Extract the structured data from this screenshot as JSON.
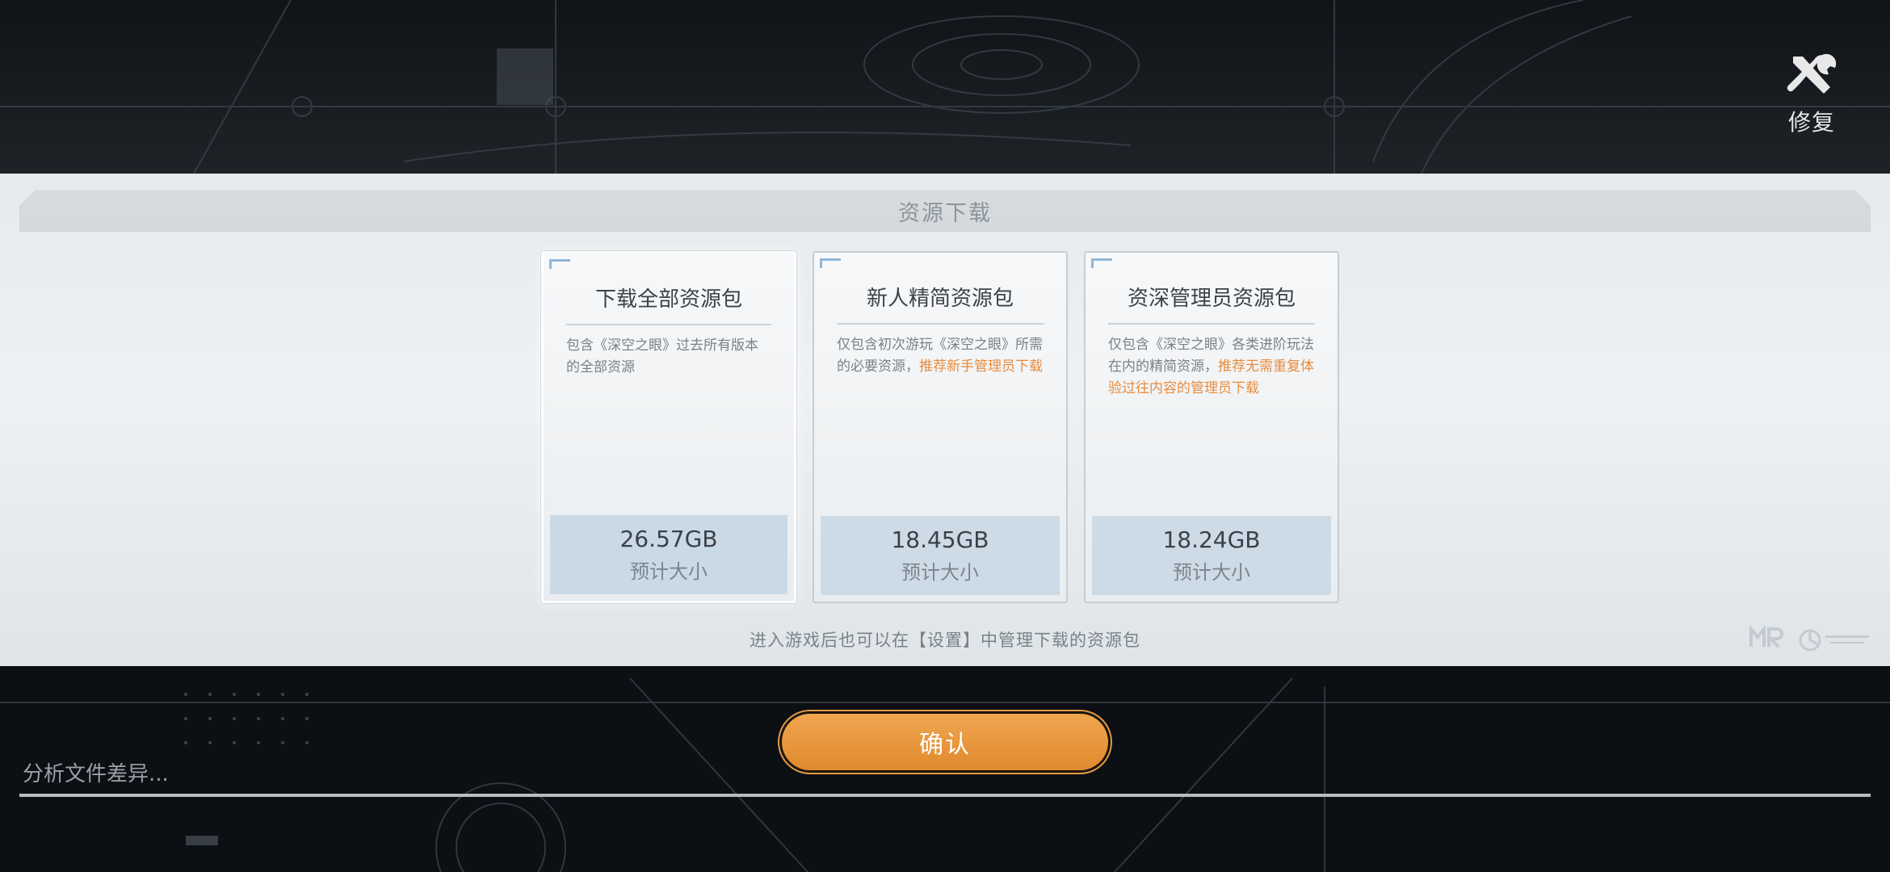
{
  "repair": {
    "label": "修复",
    "icon": "tools-icon"
  },
  "panel": {
    "title": "资源下载",
    "footer_note": "进入游戏后也可以在【设置】中管理下载的资源包"
  },
  "cards": [
    {
      "title": "下载全部资源包",
      "desc_plain": "包含《深空之眼》过去所有版本的全部资源",
      "desc_highlight": "",
      "size": "26.57GB",
      "size_label": "预计大小",
      "selected": true
    },
    {
      "title": "新人精简资源包",
      "desc_plain": "仅包含初次游玩《深空之眼》所需的必要资源，",
      "desc_highlight": "推荐新手管理员下载",
      "size": "18.45GB",
      "size_label": "预计大小",
      "selected": false
    },
    {
      "title": "资深管理员资源包",
      "desc_plain": "仅包含《深空之眼》各类进阶玩法在内的精简资源，",
      "desc_highlight": "推荐无需重复体验过往内容的管理员下载",
      "size": "18.24GB",
      "size_label": "预计大小",
      "selected": false
    }
  ],
  "confirm": {
    "label": "确认"
  },
  "status": {
    "text": "分析文件差异...",
    "progress": 1.0
  },
  "colors": {
    "accent_orange": "#e88c3d",
    "confirm_button": "#ec9c45",
    "panel_bg": "#e9edf0",
    "size_box": "#cddbe7"
  }
}
